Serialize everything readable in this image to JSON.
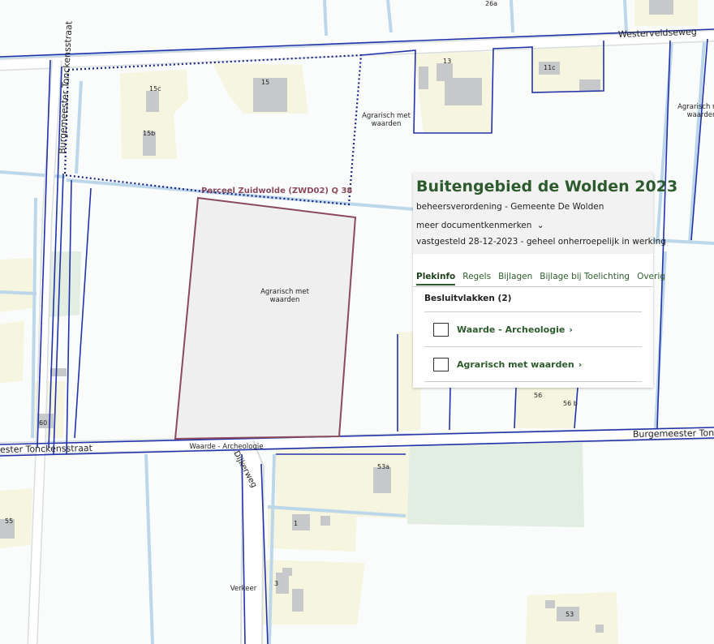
{
  "map": {
    "street_names": {
      "westerveldseweg": "Westerveldseweg",
      "burgemeester_tonckensstraat_vertical": "Burgemeester Tonckensstraat",
      "burgemeester_tonckensstraat_left": "ester Tonckensstraat",
      "burgemeester_tonckensstraat_right": "Burgemeester Tonck",
      "dijkerweg": "Dijkerweg"
    },
    "house_numbers": {
      "n15c": "15c",
      "n15": "15",
      "n15b": "15b",
      "n13": "13",
      "n11c": "11c",
      "n26a": "26a",
      "n60": "60",
      "n55": "55",
      "n53a": "53a",
      "n1": "1",
      "n3": "3",
      "n53": "53",
      "n56": "56",
      "n56b": "56 b"
    },
    "zone_labels": {
      "agrarisch_1": "Agrarisch met\nwaarden",
      "agrarisch_2": "Agrarisch met\nwaarden",
      "agrarisch_3": "Agrarisch met\nwaarden",
      "waarde_archeologie": "Waarde - Archeologie",
      "verkeer": "Verkeer"
    },
    "parcel_label": "Perceel Zuidwolde (ZWD02) Q 38",
    "colors": {
      "background": "#fafcfb",
      "residential": "#f6f6e0",
      "green": "#e2eee2",
      "water": "#bcd7ea",
      "plan_boundary": "#2233aa",
      "selected_fill": "#efeff0",
      "selected_border": "#8a4a5c",
      "parcel_label": "#8a4a5c",
      "title": "#2d5b2d"
    }
  },
  "panel": {
    "title": "Buitengebied de Wolden 2023",
    "subtitle": "beheersverordening - Gemeente De Wolden",
    "more_label": "meer documentkenmerken",
    "status": "vastgesteld 28-12-2023 - geheel onherroepelijk in werking",
    "tabs": [
      "Plekinfo",
      "Regels",
      "Bijlagen",
      "Bijlage bij Toelichting",
      "Overig"
    ],
    "section_title": "Besluitvlakken (2)",
    "items": [
      "Waarde - Archeologie",
      "Agrarisch met waarden"
    ]
  }
}
